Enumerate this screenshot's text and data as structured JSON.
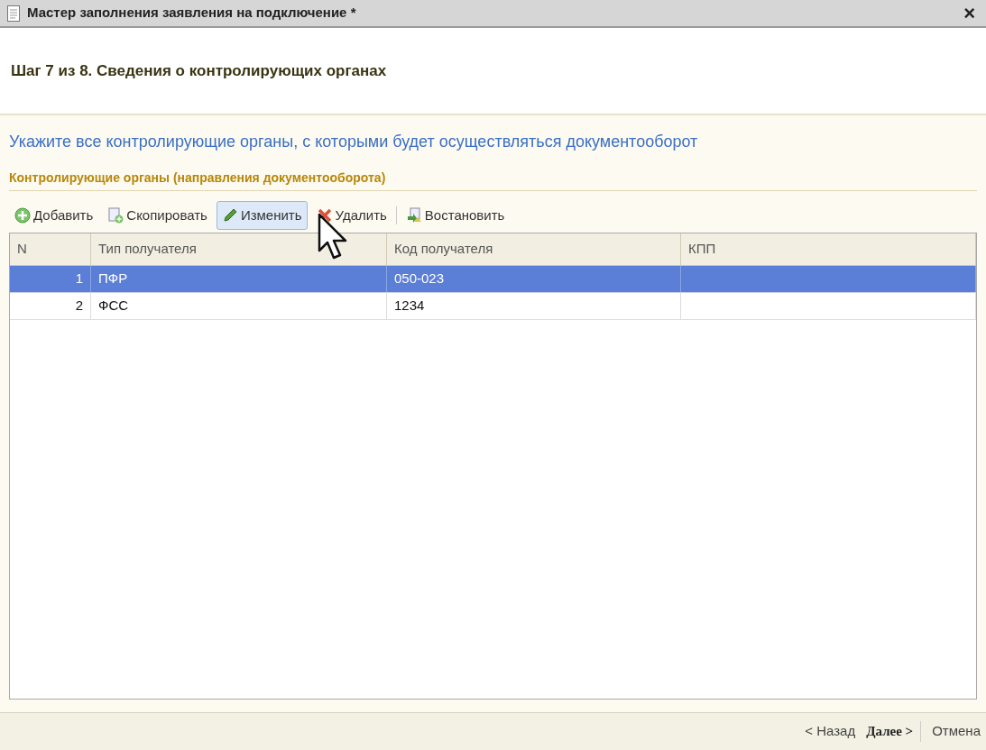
{
  "window": {
    "title": "Мастер заполнения заявления на подключение *",
    "close": "×"
  },
  "step_title": "Шаг 7 из 8. Сведения о контролирующих органах",
  "instruction": "Укажите все контролирующие органы, с которыми будет осуществляться документооборот",
  "group_title": "Контролирующие органы (направления документооборота)",
  "toolbar": [
    {
      "kind": "add",
      "label": "Добавить",
      "hovered": false
    },
    {
      "kind": "copy",
      "label": "Скопировать",
      "hovered": false
    },
    {
      "kind": "edit",
      "label": "Изменить",
      "hovered": true
    },
    {
      "kind": "delete",
      "label": "Удалить",
      "hovered": false
    },
    {
      "kind": "restore",
      "label": "Востановить",
      "hovered": false
    }
  ],
  "table": {
    "columns": [
      "N",
      "Тип получателя",
      "Код получателя",
      "КПП"
    ],
    "rows": [
      {
        "cells": [
          "1",
          "ПФР",
          "050-023",
          ""
        ],
        "selected": true
      },
      {
        "cells": [
          "2",
          "ФСС",
          "1234",
          ""
        ],
        "selected": false
      }
    ]
  },
  "footer": {
    "back": "< Назад",
    "next": "Далее >",
    "cancel": "Отмена"
  }
}
